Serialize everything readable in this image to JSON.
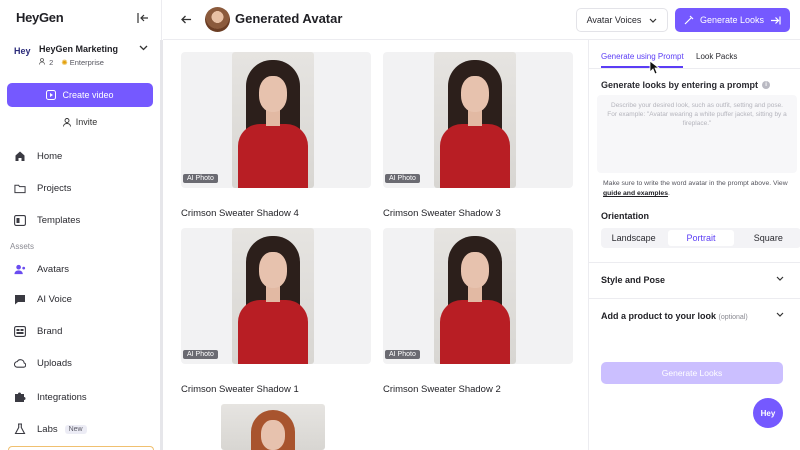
{
  "app": {
    "logo": "HeyGen"
  },
  "workspace": {
    "logo": "Hey",
    "name": "HeyGen Marketing",
    "members": "2",
    "plan": "Enterprise"
  },
  "sidebar": {
    "create_label": "Create video",
    "invite_label": "Invite",
    "nav_top": [
      {
        "label": "Home",
        "icon": "home-icon"
      },
      {
        "label": "Projects",
        "icon": "folder-icon"
      },
      {
        "label": "Templates",
        "icon": "template-icon"
      }
    ],
    "assets_label": "Assets",
    "nav_assets": [
      {
        "label": "Avatars",
        "icon": "avatar-icon"
      },
      {
        "label": "AI Voice",
        "icon": "voice-icon"
      },
      {
        "label": "Brand",
        "icon": "brand-icon"
      },
      {
        "label": "Uploads",
        "icon": "upload-icon"
      },
      {
        "label": "Integrations",
        "icon": "puzzle-icon"
      },
      {
        "label": "Labs",
        "icon": "flask-icon",
        "badge": "New"
      }
    ]
  },
  "header": {
    "title": "Generated Avatar",
    "voices_dropdown": "Avatar Voices",
    "generate_button": "Generate Looks"
  },
  "cards": [
    {
      "title": "Crimson Sweater Shadow 4",
      "tag": "AI Photo"
    },
    {
      "title": "Crimson Sweater Shadow 3",
      "tag": "AI Photo"
    },
    {
      "title": "Crimson Sweater Shadow 1",
      "tag": "AI Photo"
    },
    {
      "title": "Crimson Sweater Shadow 2",
      "tag": "AI Photo"
    }
  ],
  "panel": {
    "tabs": [
      {
        "label": "Generate using Prompt",
        "active": true
      },
      {
        "label": "Look Packs",
        "active": false
      }
    ],
    "prompt_label": "Generate looks by entering a prompt",
    "prompt_placeholder": "Describe your desired look, such as outfit, setting and pose. For example: \"Avatar wearing a white puffer jacket, sitting by a fireplace.\"",
    "hint_text": "Make sure to write the word avatar in the prompt above. View",
    "hint_link": "guide and examples",
    "hint_end": ".",
    "orientation_label": "Orientation",
    "orientation_options": [
      "Landscape",
      "Portrait",
      "Square"
    ],
    "orientation_selected": "Portrait",
    "style_pose_label": "Style and Pose",
    "product_label": "Add a product to your look",
    "product_optional": "(optional)",
    "generate_button": "Generate Looks",
    "chat_bubble": "Hey"
  },
  "colors": {
    "accent": "#7559ff",
    "accent_text": "#5b3df5",
    "accent_disabled": "#cbbfff",
    "sweater": "#b81e24"
  }
}
